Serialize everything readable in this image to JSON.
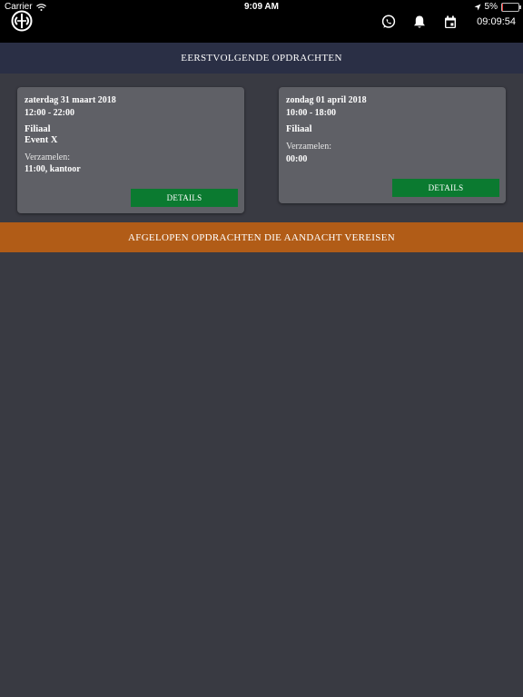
{
  "status_bar": {
    "carrier": "Carrier",
    "time": "9:09 AM",
    "battery": "5%",
    "battery_level": 0.05
  },
  "topbar": {
    "clock": "09:09:54",
    "icons": [
      "logo-icon",
      "whatsapp-icon",
      "bell-icon",
      "calendar-icon"
    ],
    "accent": "#000000"
  },
  "upcoming": {
    "header": "EERSTVOLGENDE OPDRACHTEN",
    "header_color": "#2a2f45",
    "cards": [
      {
        "date": "zaterdag 31 maart 2018",
        "time": "12:00 - 22:00",
        "place": "Filiaal",
        "event": "Event X",
        "gather_label": "Verzamelen:",
        "gather_value": "11:00, kantoor",
        "button": "DETAILS"
      },
      {
        "date": "zondag 01 april 2018",
        "time": "10:00 - 18:00",
        "place": "Filiaal",
        "event": "",
        "gather_label": "Verzamelen:",
        "gather_value": "00:00",
        "button": "DETAILS"
      }
    ]
  },
  "attention": {
    "header": "AFGELOPEN OPDRACHTEN DIE AANDACHT VEREISEN",
    "color": "#b15c17"
  },
  "colors": {
    "background": "#393a42",
    "card": "#5f6066",
    "button": "#0b7a30"
  }
}
